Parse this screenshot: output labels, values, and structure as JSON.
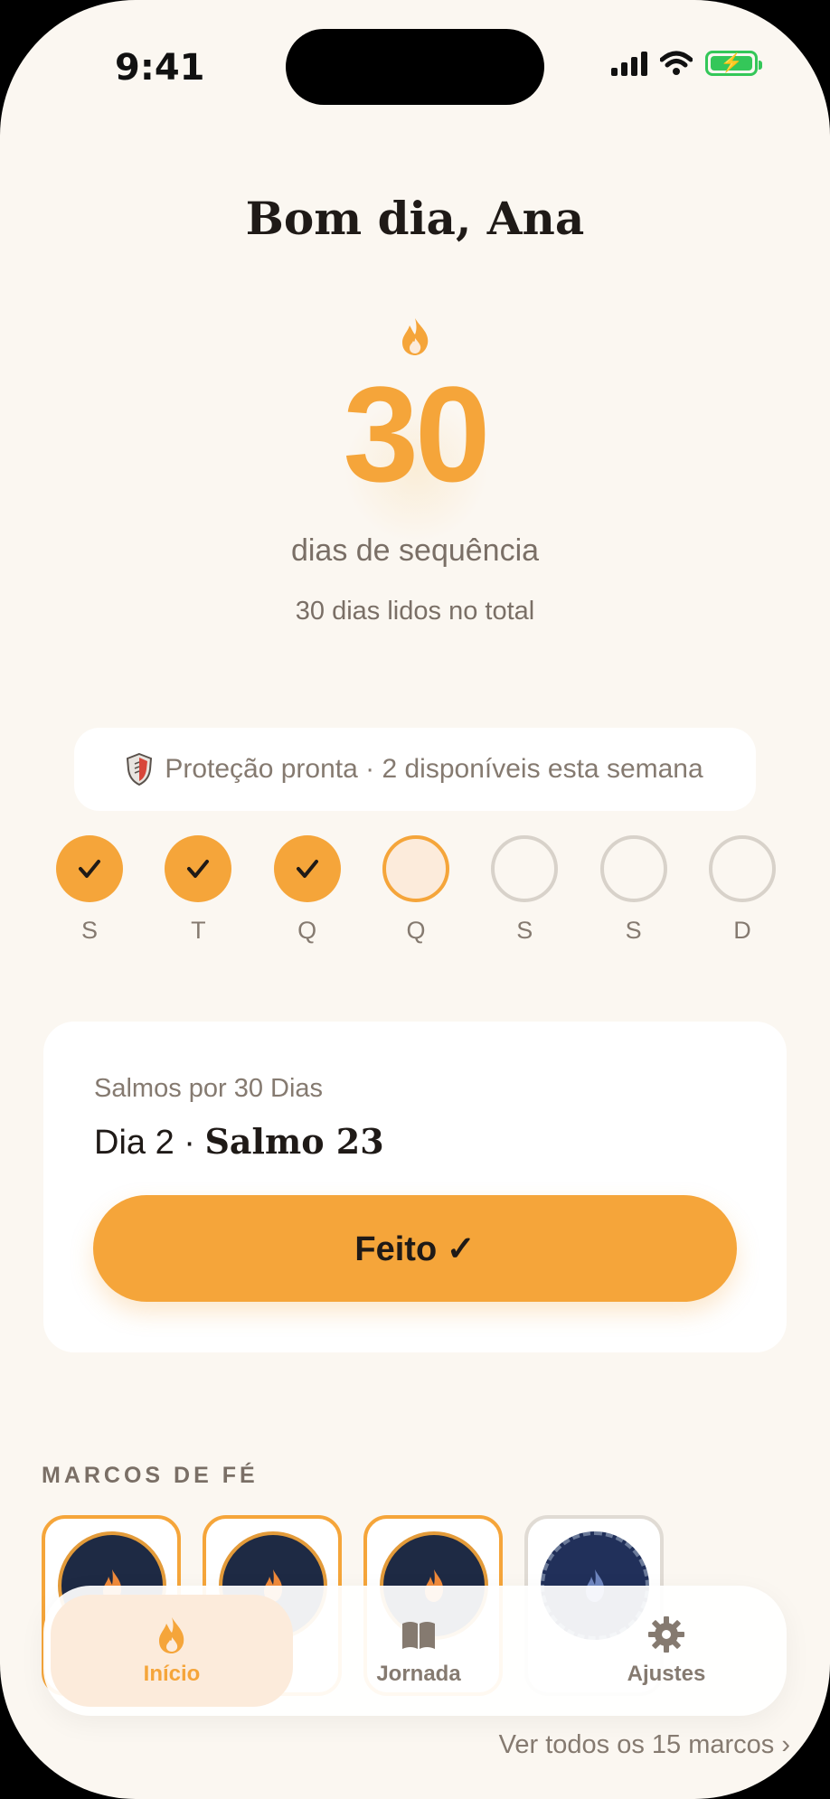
{
  "status_bar": {
    "time": "9:41"
  },
  "header": {
    "greeting": "Bom dia, Ana"
  },
  "streak": {
    "icon": "flame-icon",
    "count": "30",
    "label": "dias de sequência",
    "total": "30 dias lidos no total"
  },
  "protection": {
    "icon": "shield-icon",
    "text": "Proteção pronta · 2 disponíveis esta semana"
  },
  "week": [
    {
      "letter": "S",
      "state": "done"
    },
    {
      "letter": "T",
      "state": "done"
    },
    {
      "letter": "Q",
      "state": "done"
    },
    {
      "letter": "Q",
      "state": "today"
    },
    {
      "letter": "S",
      "state": "future"
    },
    {
      "letter": "S",
      "state": "future"
    },
    {
      "letter": "D",
      "state": "future"
    }
  ],
  "reading_card": {
    "plan": "Salmos por 30 Dias",
    "day": "Dia 2 · ",
    "psalm": "Salmo 23",
    "button": "Feito ✓"
  },
  "milestones": {
    "title": "MARCOS DE FÉ",
    "see_all": "Ver todos os 15 marcos ›",
    "badges": [
      {
        "state": "earned"
      },
      {
        "state": "earned"
      },
      {
        "state": "earned"
      },
      {
        "state": "locked"
      }
    ]
  },
  "tabbar": {
    "tabs": [
      {
        "label": "Início",
        "icon": "flame-icon",
        "active": true
      },
      {
        "label": "Jornada",
        "icon": "book-icon",
        "active": false
      },
      {
        "label": "Ajustes",
        "icon": "gear-icon",
        "active": false
      }
    ]
  },
  "colors": {
    "accent": "#F5A53A",
    "background": "#FBF7F1",
    "muted": "#857A70"
  }
}
